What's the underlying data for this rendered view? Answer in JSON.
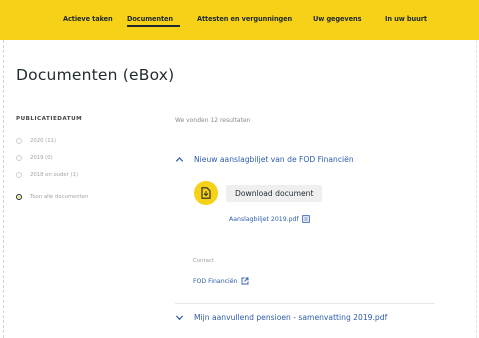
{
  "colors": {
    "nav_bg": "#f7d117",
    "link": "#2d5cab",
    "text": "#1f2a30"
  },
  "nav": {
    "items": [
      {
        "label": "Actieve taken"
      },
      {
        "label": "Documenten"
      },
      {
        "label": "Attesten en vergunningen"
      },
      {
        "label": "Uw gegevens"
      },
      {
        "label": "In uw buurt"
      }
    ],
    "active_index": 1
  },
  "page": {
    "title": "Documenten (eBox)"
  },
  "filter": {
    "heading": "PUBLICATIEDATUM",
    "options": [
      {
        "label": "2020 (11)",
        "selected": false
      },
      {
        "label": "2019 (0)",
        "selected": false
      },
      {
        "label": "2018 en ouder (1)",
        "selected": false
      },
      {
        "label": "Toon alle documenten",
        "selected": true
      }
    ]
  },
  "results": {
    "count_text": "We vonden 12 resultaten",
    "items": [
      {
        "title": "Nieuw aanslagbiljet van de FOD Financiën",
        "expanded": true,
        "download_label": "Download document",
        "file_label": "Aanslagbiljet 2019.pdf",
        "contact_label": "Contact",
        "contact_value": "FOD Financiën"
      },
      {
        "title": "Mijn aanvullend pensioen - samenvatting 2019.pdf",
        "expanded": false
      }
    ]
  }
}
